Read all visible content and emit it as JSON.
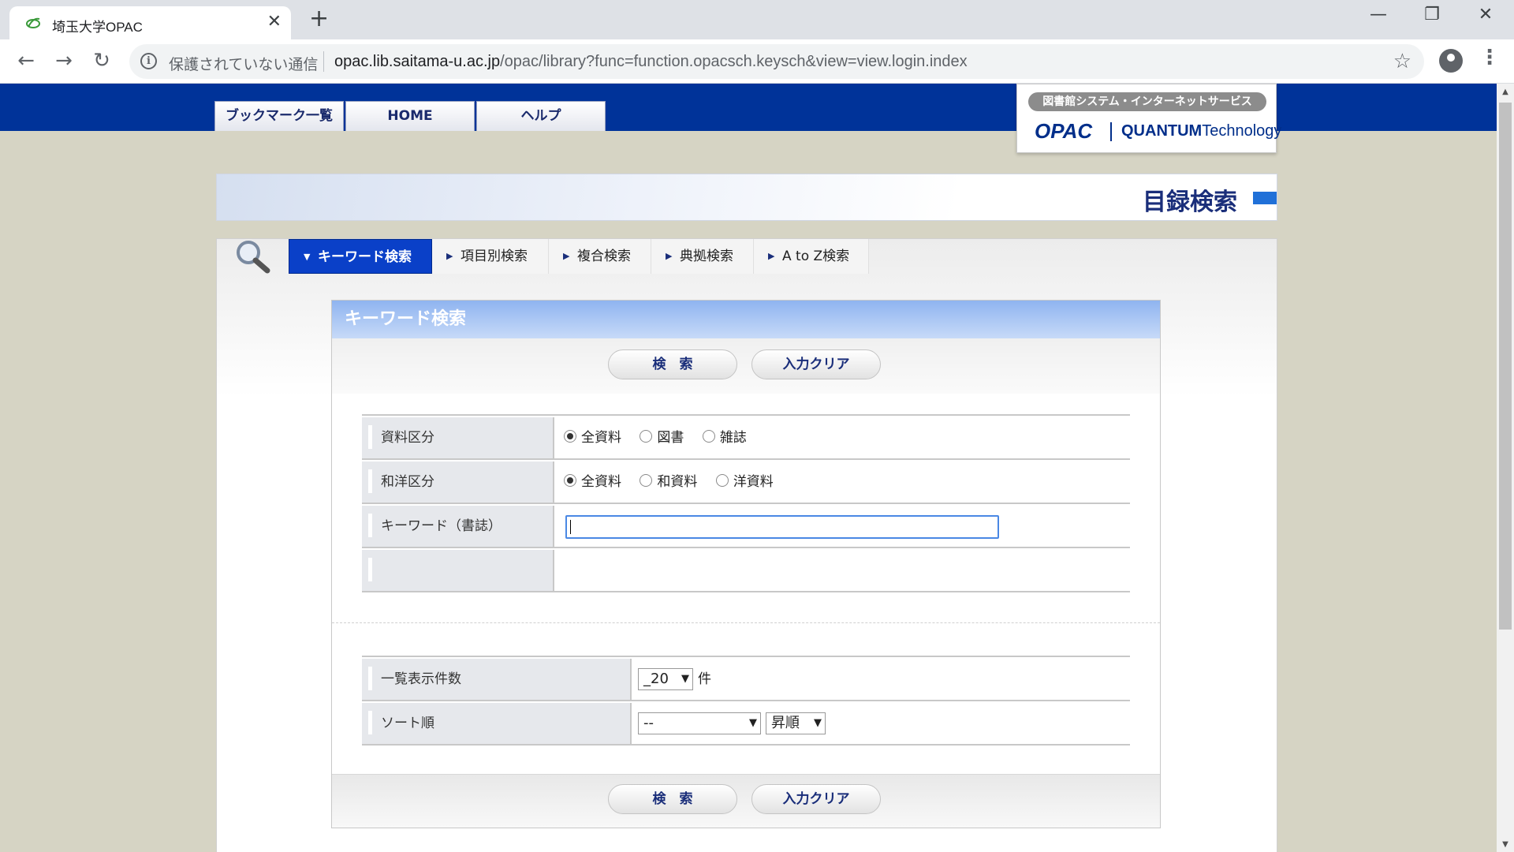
{
  "browser": {
    "tab_title": "埼玉大学OPAC",
    "security_label": "保護されていない通信",
    "url_host": "opac.lib.saitama-u.ac.jp",
    "url_path": "/opac/library?func=function.opacsch.keysch&view=view.login.index"
  },
  "site": {
    "nav_tabs": [
      "ブックマーク一覧",
      "HOME",
      "ヘルプ"
    ],
    "logo_tagline": "図書館システム・インターネットサービス",
    "logo_opac": "OPAC",
    "logo_quantum": "QUANTUM",
    "logo_technology": "Technology",
    "page_title": "目録検索"
  },
  "search_tabs": [
    {
      "label": "キーワード検索",
      "active": true
    },
    {
      "label": "項目別検索",
      "active": false
    },
    {
      "label": "複合検索",
      "active": false
    },
    {
      "label": "典拠検索",
      "active": false
    },
    {
      "label": "A to Z検索",
      "active": false
    }
  ],
  "form": {
    "heading": "キーワード検索",
    "search_button": "検　索",
    "clear_button": "入力クリア",
    "material_type": {
      "label": "資料区分",
      "options": [
        "全資料",
        "図書",
        "雑誌"
      ],
      "selected": "全資料"
    },
    "language_type": {
      "label": "和洋区分",
      "options": [
        "全資料",
        "和資料",
        "洋資料"
      ],
      "selected": "全資料"
    },
    "keyword": {
      "label": "キーワード（書誌）",
      "value": ""
    },
    "display_count": {
      "label": "一覧表示件数",
      "value": "_20",
      "unit": "件"
    },
    "sort": {
      "label": "ソート順",
      "value": "--",
      "order": "昇順"
    }
  },
  "colors": {
    "site_bar": "#003399",
    "active_tab": "#0a40c8",
    "form_header": "#8fb4f0",
    "page_bg": "#d6d4c4"
  }
}
